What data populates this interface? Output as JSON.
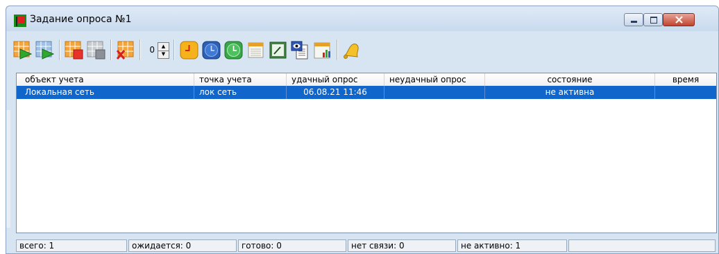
{
  "window": {
    "title": "Задание опроса  №1"
  },
  "toolbar": {
    "buttons": [
      {
        "name": "start-grid-icon"
      },
      {
        "name": "start-list-icon"
      },
      {
        "name": "stop-grid-icon"
      },
      {
        "name": "pause-grid-icon"
      },
      {
        "name": "delete-grid-icon"
      },
      {
        "name": "alarm-clock-icon"
      },
      {
        "name": "blue-clock-icon"
      },
      {
        "name": "green-clock-icon"
      },
      {
        "name": "calendar-icon"
      },
      {
        "name": "gauge-icon"
      },
      {
        "name": "view-document-icon"
      },
      {
        "name": "report-chart-icon"
      },
      {
        "name": "bell-icon"
      }
    ],
    "spinner_value": "0"
  },
  "table": {
    "columns": [
      "объект учета",
      "точка учета",
      "удачный опрос",
      "неудачный опрос",
      "состояние",
      "время"
    ],
    "rows": [
      [
        "Локальная сеть",
        "лок сеть",
        "06.08.21  11:46",
        "",
        "не активна",
        ""
      ]
    ]
  },
  "statusbar": {
    "total": "всего: 1",
    "waiting": "ожидается: 0",
    "ready": "готово: 0",
    "no_connection": "нет связи: 0",
    "inactive": "не активно: 1"
  },
  "colors": {
    "selection": "#1166cc",
    "window_bg": "#d7e4f2"
  }
}
